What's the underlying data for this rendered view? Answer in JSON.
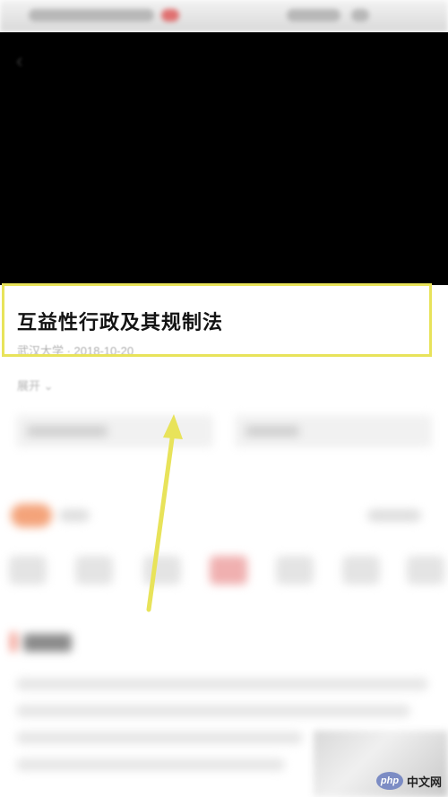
{
  "video": {
    "back_icon": "back-arrow-icon",
    "background": "#000000"
  },
  "course": {
    "title": "互益性行政及其规制法",
    "meta": "武汉大学 · 2018-10-20",
    "expand_label": "展开"
  },
  "annotation": {
    "highlight_color": "#e8e35a"
  },
  "watermark": {
    "logo_text": "php",
    "text": "中文网"
  }
}
